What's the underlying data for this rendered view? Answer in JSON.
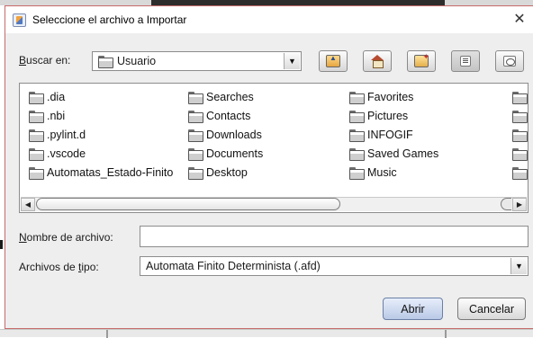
{
  "dialog": {
    "title": "Seleccione el archivo a Importar",
    "close_glyph": "✕"
  },
  "look_in": {
    "label_mnemonic": "B",
    "label_rest": "uscar en:",
    "value": "Usuario"
  },
  "toolbar": {
    "buttons": [
      "up-one-level",
      "home",
      "new-folder",
      "list-view",
      "details-view"
    ]
  },
  "files": {
    "columns": [
      [
        "dia",
        "nbi",
        "pylint.d",
        "vscode",
        "Automatas_Estado-Finito"
      ],
      [
        "Searches",
        "Contacts",
        "Downloads",
        "Documents",
        "Desktop"
      ],
      [
        "Favorites",
        "Pictures",
        "INFOGIF",
        "Saved Games",
        "Music"
      ]
    ],
    "col1_prefix": ".",
    "display": [
      [
        ".dia",
        ".nbi",
        ".pylint.d",
        ".vscode",
        "Automatas_Estado-Finito"
      ],
      [
        "Searches",
        "Contacts",
        "Downloads",
        "Documents",
        "Desktop"
      ],
      [
        "Favorites",
        "Pictures",
        "INFOGIF",
        "Saved Games",
        "Music"
      ]
    ]
  },
  "file_name": {
    "label_mnemonic": "N",
    "label_rest": "ombre de archivo:",
    "value": ""
  },
  "file_type": {
    "label_pre": "Archivos de ",
    "label_mnemonic": "t",
    "label_rest": "ipo:",
    "value": "Automata Finito Determinista (.afd)"
  },
  "buttons": {
    "open": "Abrir",
    "cancel": "Cancelar"
  },
  "colors": {
    "dialog_border": "#c66a6a",
    "dialog_bg": "#eeeeee",
    "open_button": "#b9c9e6"
  }
}
